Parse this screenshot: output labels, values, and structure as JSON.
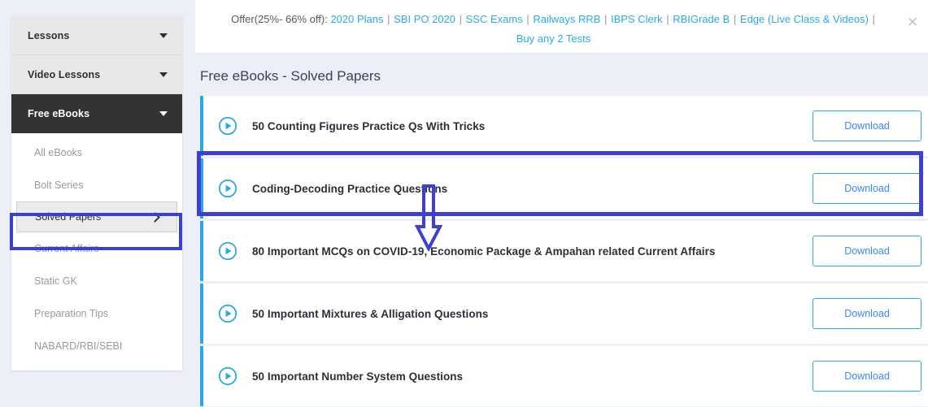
{
  "offer": {
    "prefix": "Offer(25%- 66% off):",
    "links": [
      "2020 Plans",
      "SBI PO 2020",
      "SSC Exams",
      "Railways RRB",
      "IBPS Clerk",
      "RBIGrade B",
      "Edge (Live Class & Videos)"
    ],
    "separator": "|",
    "second_line": "Buy any 2 Tests",
    "close_icon": "×"
  },
  "sidebar": {
    "top_items": [
      {
        "label": "Lessons",
        "active": false
      },
      {
        "label": "Video Lessons",
        "active": false
      },
      {
        "label": "Free eBooks",
        "active": true
      }
    ],
    "sub_items": [
      {
        "label": "All eBooks",
        "selected": false
      },
      {
        "label": "Bolt Series",
        "selected": false
      },
      {
        "label": "Solved Papers",
        "selected": true
      },
      {
        "label": "Current Affairs",
        "selected": false
      },
      {
        "label": "Static GK",
        "selected": false
      },
      {
        "label": "Preparation Tips",
        "selected": false
      },
      {
        "label": "NABARD/RBI/SEBI",
        "selected": false
      }
    ]
  },
  "main": {
    "page_title": "Free eBooks - Solved Papers",
    "download_label": "Download",
    "rows": [
      {
        "title": "50 Counting Figures Practice Qs With Tricks"
      },
      {
        "title": "Coding-Decoding Practice Questions"
      },
      {
        "title": "80 Important MCQs on COVID-19, Economic Package & Ampahan related Current Affairs"
      },
      {
        "title": "50 Important Mixtures & Alligation Questions"
      },
      {
        "title": "50 Important Number System Questions"
      }
    ]
  },
  "colors": {
    "accent_blue": "#29abe2",
    "link_blue": "#3988f5",
    "highlight_purple": "#3d3fd1",
    "page_bg": "#eceff7",
    "active_nav_bg": "#333333"
  }
}
